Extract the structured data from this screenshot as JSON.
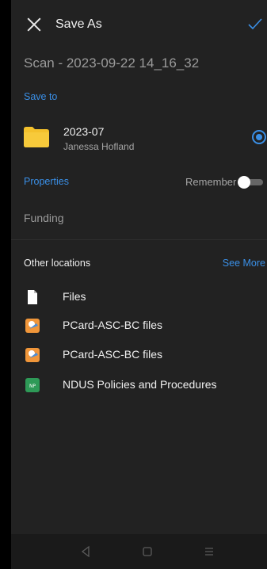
{
  "header": {
    "title": "Save As"
  },
  "filename": "Scan - 2023-09-22 14_16_32",
  "save_to": {
    "label": "Save to",
    "folder_name": "2023-07",
    "owner": "Janessa Hofland"
  },
  "properties": {
    "label": "Properties",
    "remember_label": "Remember",
    "remember_on": false,
    "value": "Funding"
  },
  "other_locations": {
    "label": "Other locations",
    "see_more": "See More",
    "items": [
      {
        "label": "Files",
        "icon": "file-icon"
      },
      {
        "label": "PCard-ASC-BC files",
        "icon": "sharepoint-icon"
      },
      {
        "label": "PCard-ASC-BC files",
        "icon": "sharepoint-icon"
      },
      {
        "label": "NDUS Policies and Procedures",
        "icon": "np-site-icon",
        "badge": "NP"
      }
    ]
  },
  "colors": {
    "accent": "#3a8fe6",
    "background": "#222222",
    "folder": "#f4c12c"
  }
}
